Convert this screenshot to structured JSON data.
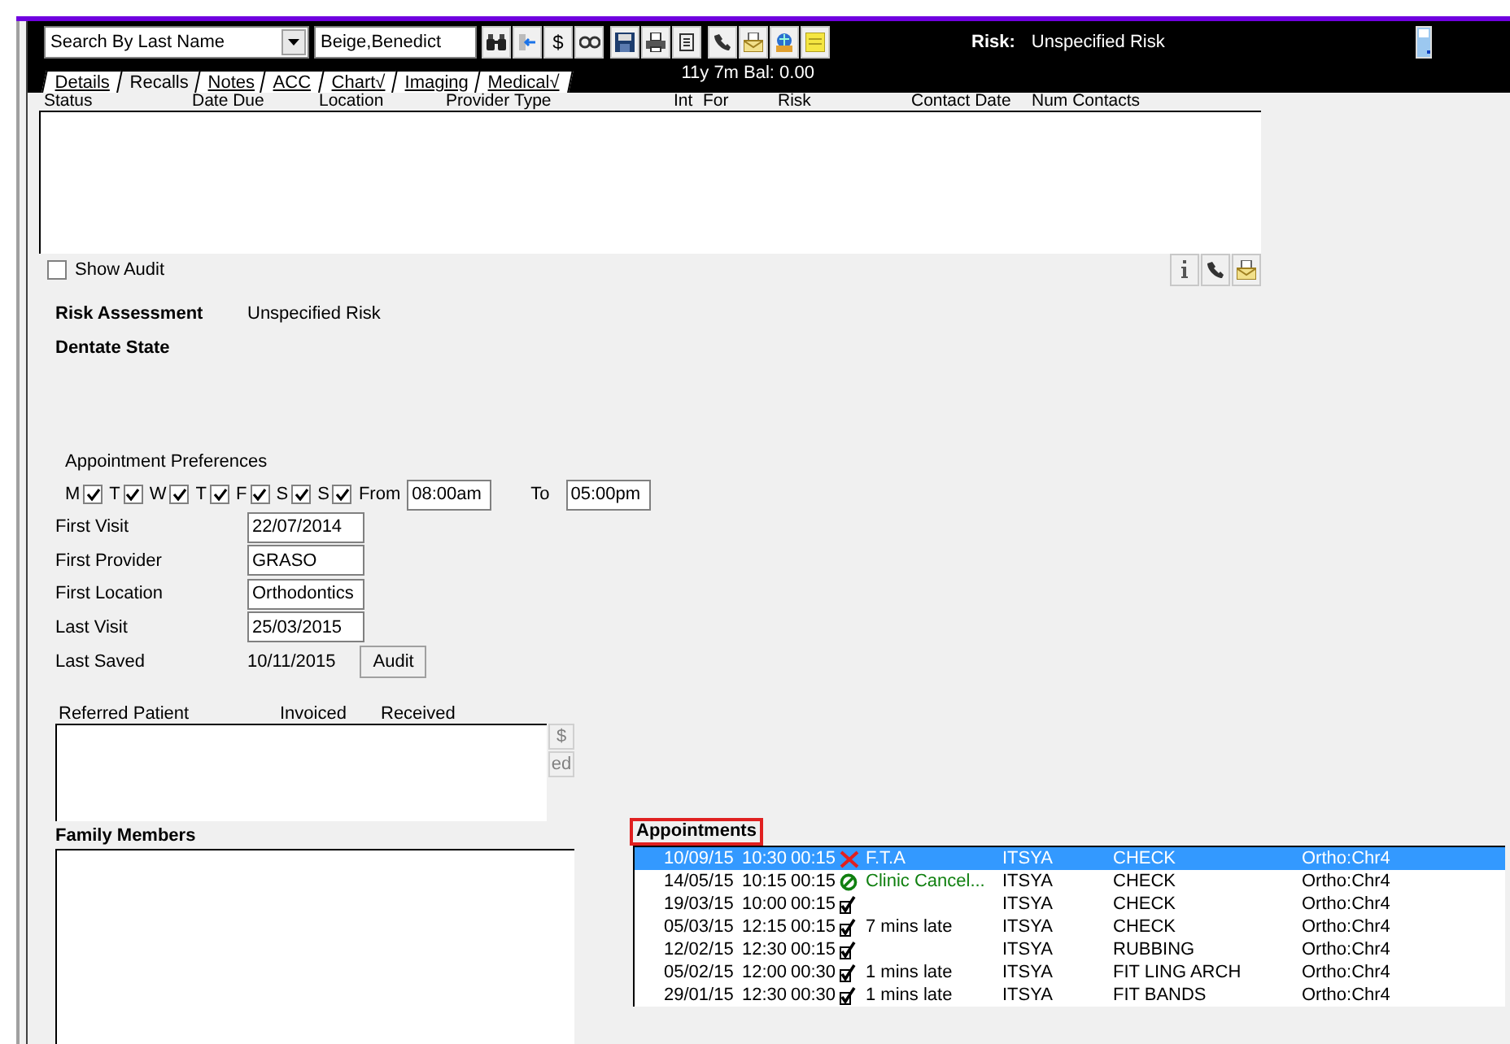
{
  "header": {
    "search_mode": "Search By Last Name",
    "patient": "Beige,Benedict",
    "dollar_button": "$",
    "risk_label": "Risk:",
    "risk_value": "Unspecified Risk",
    "age_balance": "11y 7m  Bal:  0.00"
  },
  "tabs": [
    {
      "label": "Details",
      "selected": false
    },
    {
      "label": "Recalls",
      "selected": true
    },
    {
      "label": "Notes",
      "selected": false
    },
    {
      "label": "ACC",
      "selected": false
    },
    {
      "label": "Chart√",
      "selected": false
    },
    {
      "label": "Imaging",
      "selected": false
    },
    {
      "label": "Medical√",
      "selected": false
    }
  ],
  "recalls": {
    "columns": [
      "Status",
      "Date Due",
      "Location",
      "Provider",
      "Type",
      "Int",
      "For",
      "Risk",
      "Contact Date",
      "Num Contacts"
    ],
    "show_audit": {
      "label": "Show Audit",
      "checked": false
    }
  },
  "risk_assessment": {
    "label": "Risk Assessment",
    "value": "Unspecified Risk"
  },
  "dentate_state": {
    "label": "Dentate State"
  },
  "appointment_preferences": {
    "title": "Appointment Preferences",
    "days": [
      {
        "label": "M",
        "checked": true
      },
      {
        "label": "T",
        "checked": true
      },
      {
        "label": "W",
        "checked": true
      },
      {
        "label": "T",
        "checked": true
      },
      {
        "label": "F",
        "checked": true
      },
      {
        "label": "S",
        "checked": true
      },
      {
        "label": "S",
        "checked": true
      }
    ],
    "from_label": "From",
    "from_value": "08:00am",
    "to_label": "To",
    "to_value": "05:00pm"
  },
  "fields": [
    {
      "label": "First Visit",
      "value": "22/07/2014"
    },
    {
      "label": "First Provider",
      "value": "GRASO"
    },
    {
      "label": "First Location",
      "value": "Orthodontics"
    },
    {
      "label": "Last Visit",
      "value": "25/03/2015"
    }
  ],
  "last_saved": {
    "label": "Last Saved",
    "value": "10/11/2015",
    "button": "Audit"
  },
  "referred": {
    "columns": [
      "Referred Patient",
      "Invoiced",
      "Received"
    ],
    "buttons": [
      "$",
      "ed"
    ]
  },
  "family_members": {
    "title": "Family Members"
  },
  "appointments": {
    "title": "Appointments",
    "rows": [
      {
        "date": "10/09/15",
        "time": "10:30",
        "duration": "00:15",
        "kind": "fta",
        "note": "F.T.A",
        "provider": "ITSYA",
        "type": "CHECK",
        "location": "Ortho:Chr4",
        "selected": true
      },
      {
        "date": "14/05/15",
        "time": "10:15",
        "duration": "00:15",
        "kind": "cancelled",
        "note": "Clinic Cancel...",
        "provider": "ITSYA",
        "type": "CHECK",
        "location": "Ortho:Chr4",
        "selected": false
      },
      {
        "date": "19/03/15",
        "time": "10:00",
        "duration": "00:15",
        "kind": "attended",
        "provider": "ITSYA",
        "type": "CHECK",
        "location": "Ortho:Chr4",
        "selected": false
      },
      {
        "date": "05/03/15",
        "time": "12:15",
        "duration": "00:15",
        "kind": "attended",
        "note": "7 mins late",
        "provider": "ITSYA",
        "type": "CHECK",
        "location": "Ortho:Chr4",
        "selected": false
      },
      {
        "date": "12/02/15",
        "time": "12:30",
        "duration": "00:15",
        "kind": "attended",
        "provider": "ITSYA",
        "type": "RUBBING",
        "location": "Ortho:Chr4",
        "selected": false
      },
      {
        "date": "05/02/15",
        "time": "12:00",
        "duration": "00:30",
        "kind": "attended",
        "note": "1 mins late",
        "provider": "ITSYA",
        "type": "FIT LING ARCH",
        "location": "Ortho:Chr4",
        "selected": false
      },
      {
        "date": "29/01/15",
        "time": "12:30",
        "duration": "00:30",
        "kind": "attended",
        "note": "1 mins late",
        "provider": "ITSYA",
        "type": "FIT BANDS",
        "location": "Ortho:Chr4",
        "selected": false
      }
    ]
  }
}
